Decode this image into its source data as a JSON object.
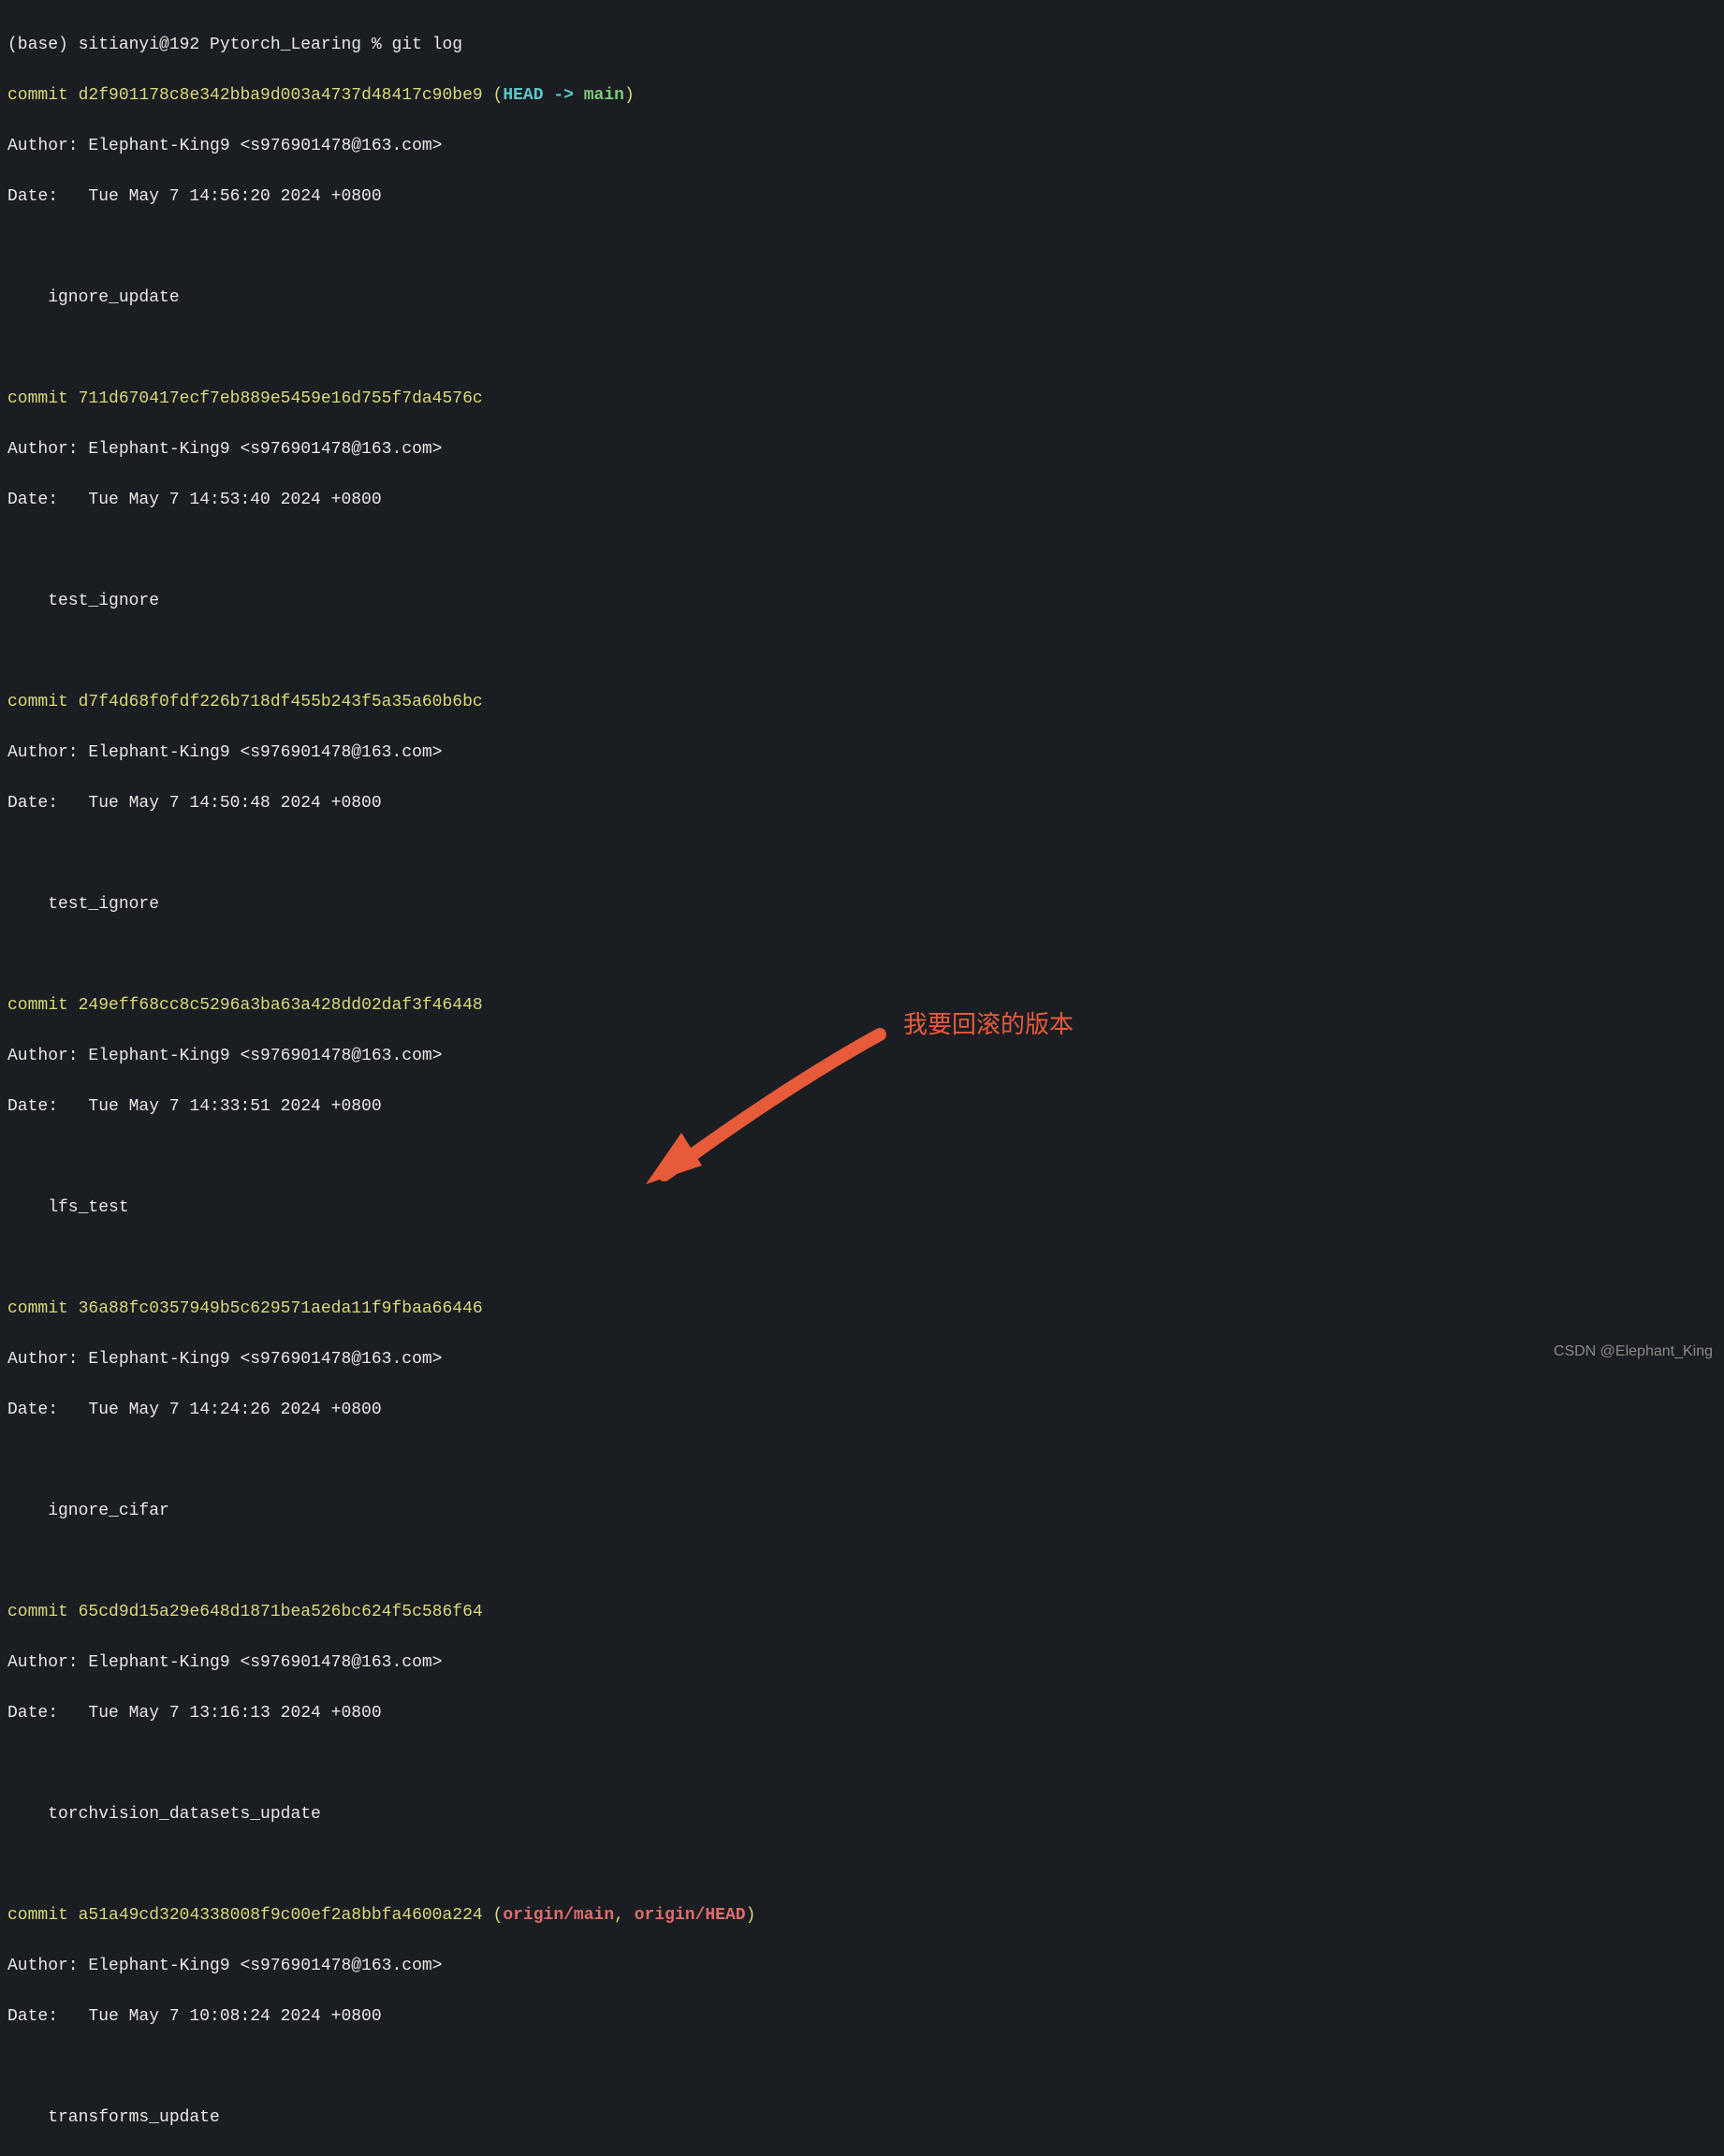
{
  "prompt": "(base) sitianyi@192 Pytorch_Learing % git log",
  "commits": [
    {
      "hash": "d2f901178c8e342bba9d003a4737d48417c90be9",
      "refs_head": "HEAD -> ",
      "refs_main": "main",
      "author": "Author: Elephant-King9 <s976901478@163.com>",
      "date": "Date:   Tue May 7 14:56:20 2024 +0800",
      "message": "    ignore_update"
    },
    {
      "hash": "711d670417ecf7eb889e5459e16d755f7da4576c",
      "author": "Author: Elephant-King9 <s976901478@163.com>",
      "date": "Date:   Tue May 7 14:53:40 2024 +0800",
      "message": "    test_ignore"
    },
    {
      "hash": "d7f4d68f0fdf226b718df455b243f5a35a60b6bc",
      "author": "Author: Elephant-King9 <s976901478@163.com>",
      "date": "Date:   Tue May 7 14:50:48 2024 +0800",
      "message": "    test_ignore"
    },
    {
      "hash": "249eff68cc8c5296a3ba63a428dd02daf3f46448",
      "author": "Author: Elephant-King9 <s976901478@163.com>",
      "date": "Date:   Tue May 7 14:33:51 2024 +0800",
      "message": "    lfs_test"
    },
    {
      "hash": "36a88fc0357949b5c629571aeda11f9fbaa66446",
      "author": "Author: Elephant-King9 <s976901478@163.com>",
      "date": "Date:   Tue May 7 14:24:26 2024 +0800",
      "message": "    ignore_cifar"
    },
    {
      "hash": "65cd9d15a29e648d1871bea526bc624f5c586f64",
      "author": "Author: Elephant-King9 <s976901478@163.com>",
      "date": "Date:   Tue May 7 13:16:13 2024 +0800",
      "message": "    torchvision_datasets_update"
    },
    {
      "hash": "a51a49cd3204338008f9c00ef2a8bbfa4600a224",
      "refs_origin_main": "origin/main",
      "refs_origin_head": "origin/HEAD",
      "author": "Author: Elephant-King9 <s976901478@163.com>",
      "date": "Date:   Tue May 7 10:08:24 2024 +0800",
      "message": "    transforms_update"
    }
  ],
  "commit_prefix": "commit ",
  "annotation": "我要回滚的版本",
  "watermark": "CSDN @Elephant_King"
}
